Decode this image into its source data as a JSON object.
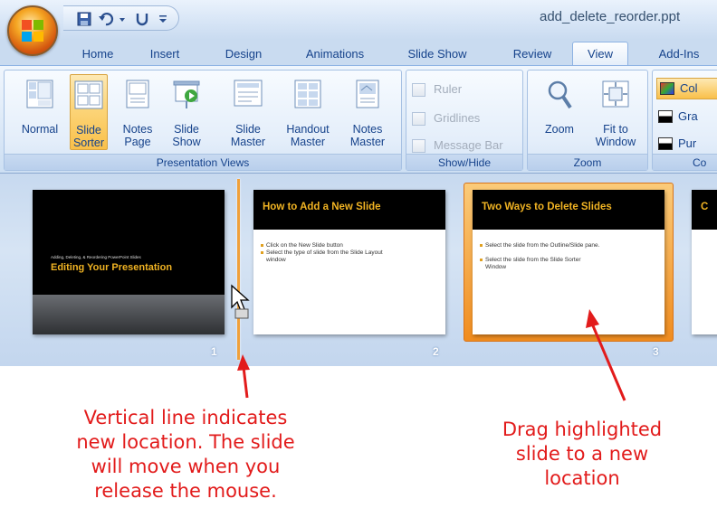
{
  "window": {
    "title": "add_delete_reorder.ppt",
    "quick_access": [
      "save-icon",
      "undo-icon",
      "redo-icon",
      "customize-icon"
    ]
  },
  "tabs": [
    "Home",
    "Insert",
    "Design",
    "Animations",
    "Slide Show",
    "Review",
    "View",
    "Add-Ins"
  ],
  "active_tab": "View",
  "ribbon": {
    "presentation_views": {
      "label": "Presentation Views",
      "buttons": [
        {
          "line1": "Normal",
          "line2": ""
        },
        {
          "line1": "Slide",
          "line2": "Sorter",
          "selected": true
        },
        {
          "line1": "Notes",
          "line2": "Page"
        },
        {
          "line1": "Slide",
          "line2": "Show"
        },
        {
          "line1": "Slide",
          "line2": "Master"
        },
        {
          "line1": "Handout",
          "line2": "Master"
        },
        {
          "line1": "Notes",
          "line2": "Master"
        }
      ]
    },
    "show_hide": {
      "label": "Show/Hide",
      "checkboxes": [
        "Ruler",
        "Gridlines",
        "Message Bar"
      ]
    },
    "zoom": {
      "label": "Zoom",
      "buttons": [
        {
          "line1": "Zoom",
          "line2": ""
        },
        {
          "line1": "Fit to",
          "line2": "Window"
        }
      ]
    },
    "color": {
      "label": "Co",
      "options": [
        "Col",
        "Gra",
        "Pur"
      ]
    }
  },
  "slides": [
    {
      "number": "1",
      "subtitle": "Adding, Deleting, & Reordering PowerPoint Slides",
      "title": "Editing Your Presentation"
    },
    {
      "number": "2",
      "title": "How to Add a New Slide",
      "bullets": [
        "Click on the New Slide button",
        "Select the type of slide from the Slide Layout window"
      ]
    },
    {
      "number": "3",
      "title": "Two Ways to Delete Slides",
      "bullets": [
        "Select the slide from the Outline/Slide pane.",
        "Select the slide from the Slide Sorter Window"
      ]
    },
    {
      "number": "",
      "title": "C"
    }
  ],
  "annotations": {
    "left": [
      "Vertical  line indicates",
      "new location.  The slide",
      "will move when you",
      "release the mouse."
    ],
    "right": [
      "Drag highlighted",
      "slide to a new",
      "location"
    ]
  },
  "colors": {
    "arrow": "#e21b1b",
    "selected_slide_border": "#f19a2c",
    "insertion_line": "#f0a03a",
    "slide_title": "#f0b323"
  }
}
